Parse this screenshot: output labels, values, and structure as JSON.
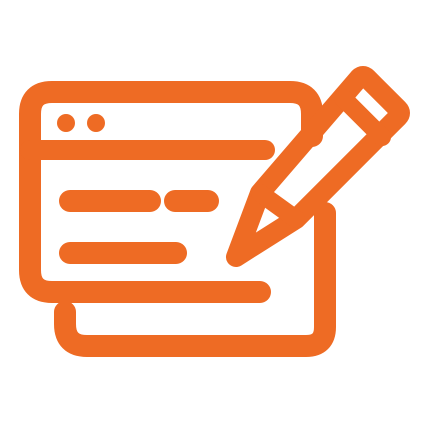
{
  "icon": {
    "name": "edit-document-icon",
    "color": "#EE6B24",
    "background": "#FFFFFF"
  }
}
